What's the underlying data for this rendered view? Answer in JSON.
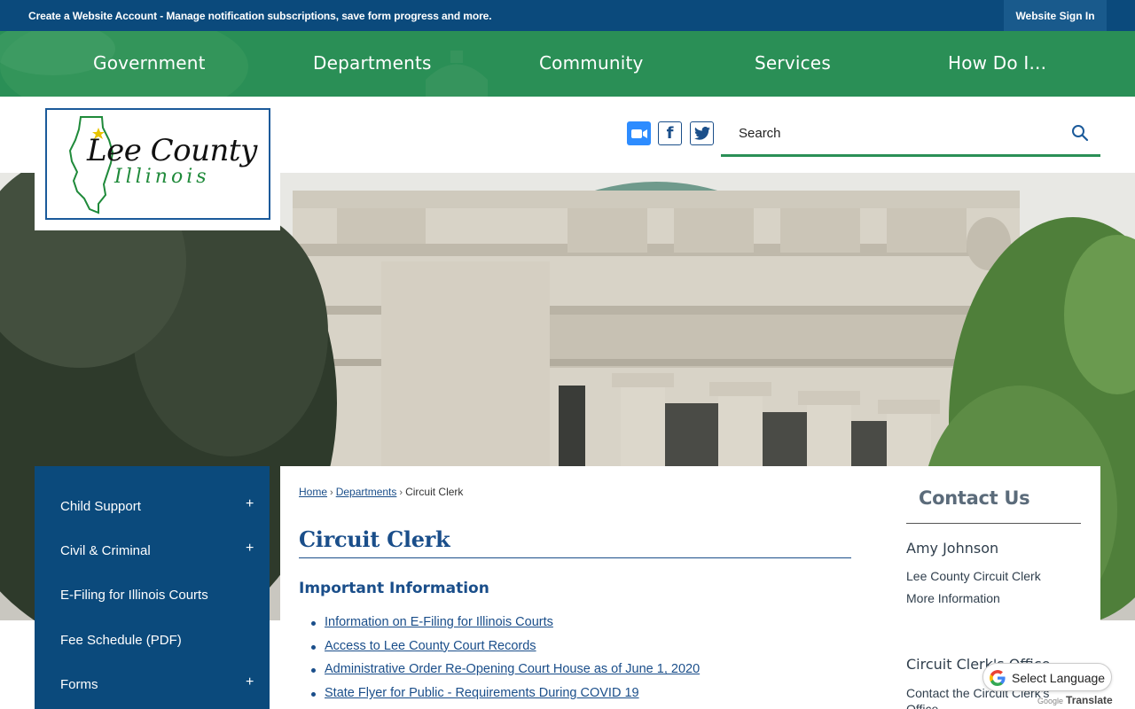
{
  "topbar": {
    "create_account": "Create a Website Account",
    "message": " - Manage notification subscriptions, save form progress and more.",
    "sign_in": "Website Sign In"
  },
  "nav": {
    "items": [
      "Government",
      "Departments",
      "Community",
      "Services",
      "How Do I..."
    ]
  },
  "logo": {
    "county": "Lee County",
    "state": "Illinois"
  },
  "social": {
    "zoom": "zoom-icon",
    "facebook": "facebook-icon",
    "twitter": "twitter-icon"
  },
  "search": {
    "placeholder": "Search"
  },
  "sidebar": {
    "items": [
      {
        "label": "Child Support",
        "expand": "+"
      },
      {
        "label": "Civil & Criminal",
        "expand": "+"
      },
      {
        "label": "E-Filing for Illinois Courts",
        "expand": ""
      },
      {
        "label": "Fee Schedule (PDF)",
        "expand": ""
      },
      {
        "label": "Forms",
        "expand": "+"
      }
    ]
  },
  "breadcrumb": {
    "home": "Home",
    "departments": "Departments",
    "current": "Circuit Clerk",
    "separator": "›"
  },
  "main": {
    "title": "Circuit Clerk",
    "subhead": "Important Information",
    "links": [
      "Information on E-Filing for Illinois Courts",
      "Access to Lee County Court Records",
      "Administrative Order Re-Opening Court House as of June 1, 2020",
      "State Flyer for Public - Requirements During COVID 19"
    ]
  },
  "contact": {
    "title": "Contact Us",
    "name": "Amy Johnson",
    "role": "Lee County Circuit Clerk",
    "more": "More Information",
    "office_title": "Circuit Clerk's Office",
    "office_text": "Contact the Circuit Clerk's Office"
  },
  "translate": {
    "label": "Select Language",
    "powered_google": "Google",
    "powered_translate": "Translate"
  },
  "colors": {
    "topbar": "#0b4a7c",
    "nav": "#2a8f56",
    "sidebar": "#0b4a7c",
    "link": "#1a4e8a"
  }
}
